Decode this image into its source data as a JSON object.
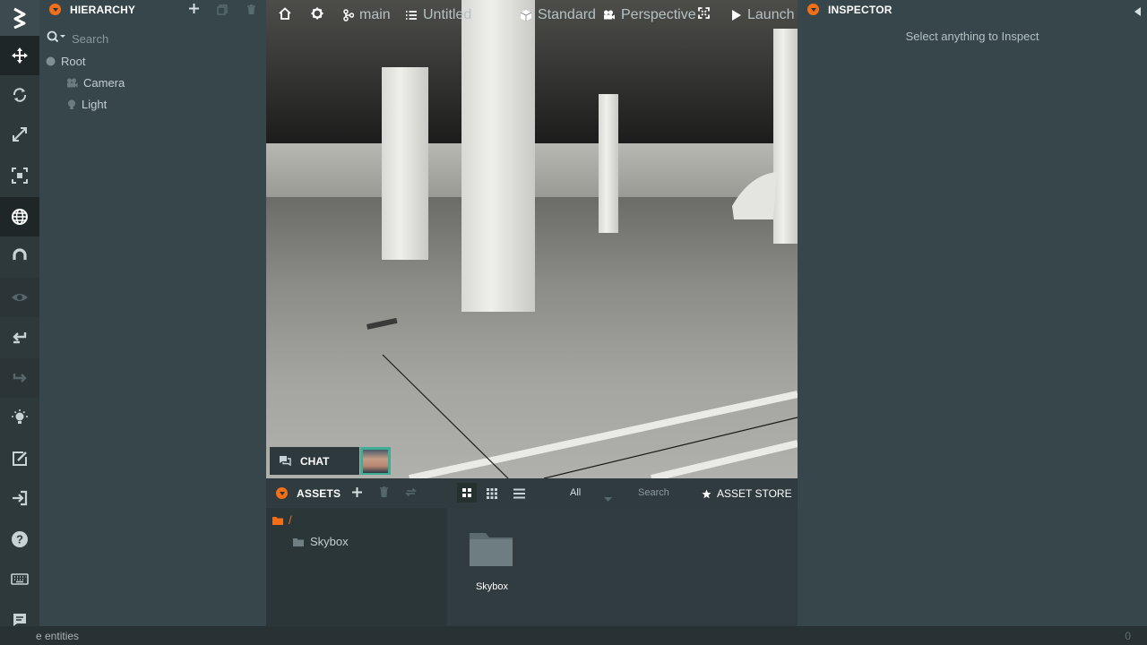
{
  "hierarchy": {
    "title": "HIERARCHY",
    "search_placeholder": "Search",
    "items": [
      {
        "label": "Root"
      },
      {
        "label": "Camera"
      },
      {
        "label": "Light"
      }
    ]
  },
  "viewport": {
    "branch": "main",
    "scene": "Untitled",
    "render_mode": "Standard",
    "camera": "Perspective",
    "launch": "Launch"
  },
  "chat": {
    "label": "CHAT"
  },
  "assets": {
    "title": "ASSETS",
    "filter": "All",
    "search_placeholder": "Search",
    "store": "ASSET STORE",
    "path": "/",
    "tree_items": [
      {
        "label": "Skybox"
      }
    ],
    "grid_items": [
      {
        "label": "Skybox"
      }
    ]
  },
  "inspector": {
    "title": "INSPECTOR",
    "empty_message": "Select anything to Inspect"
  },
  "statusbar": {
    "text": "e entities",
    "right": "0"
  },
  "colors": {
    "accent": "#f26f1a",
    "panel": "#36464a",
    "toolbar": "#2e393c"
  },
  "toolbar_icons": [
    "logo-icon",
    "move-icon",
    "rotate-icon",
    "scale-icon",
    "resize-icon",
    "world-icon",
    "magnet-icon",
    "eye-icon",
    "undo-icon",
    "redo-icon",
    "light-icon",
    "edit-icon",
    "publish-icon",
    "help-icon",
    "keyboard-icon",
    "chat-icon"
  ]
}
